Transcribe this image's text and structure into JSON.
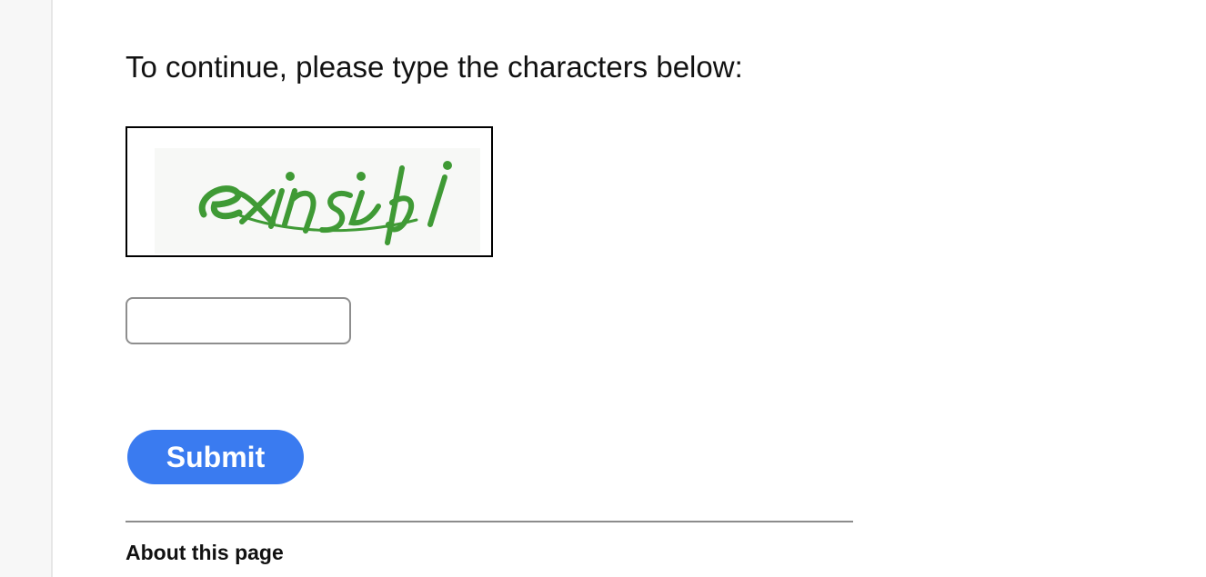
{
  "prompt": {
    "text": "To continue, please type the characters below:"
  },
  "captcha": {
    "characters": "exinsibi",
    "color": "#3f9a35"
  },
  "input": {
    "value": "",
    "placeholder": ""
  },
  "submit": {
    "label": "Submit",
    "color": "#3a7bf0"
  },
  "footer": {
    "about_heading": "About this page"
  }
}
